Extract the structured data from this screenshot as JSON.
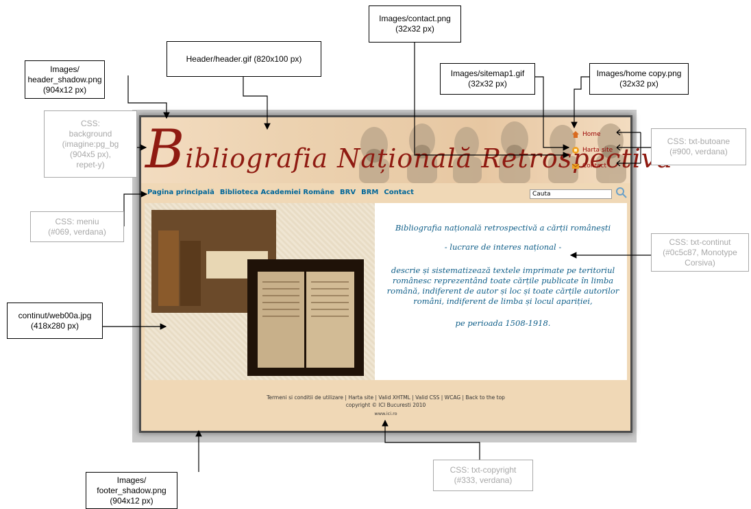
{
  "annotations": {
    "contact_png": [
      "Images/contact.png",
      "(32x32 px)"
    ],
    "header_gif": [
      "Header/header.gif (820x100 px)"
    ],
    "sitemap_gif": [
      "Images/sitemap1.gif",
      "(32x32 px)"
    ],
    "home_png": [
      "Images/home copy.png",
      "(32x32 px)"
    ],
    "header_shadow": [
      "Images/",
      "header_shadow.png",
      "(904x12 px)"
    ],
    "css_background": [
      "CSS:",
      "background",
      "(imagine:pg_bg",
      "(904x5 px),",
      "repet-y)"
    ],
    "css_butoane": [
      "CSS: txt-butoane",
      "(#900, verdana)"
    ],
    "css_meniu": [
      "CSS: meniu",
      "(#069, verdana)"
    ],
    "css_continut": [
      "CSS: txt-continut",
      "(#0c5c87, Monotype",
      "Corsiva)"
    ],
    "continut_jpg": [
      "continut/web00a.jpg",
      "(418x280 px)"
    ],
    "css_copyright": [
      "CSS: txt-copyright",
      "(#333, verdana)"
    ],
    "footer_shadow": [
      "Images/",
      "footer_shadow.png",
      "(904x12 px)"
    ]
  },
  "site": {
    "logo_initial": "B",
    "logo_rest": "ibliografia Națională Retrospectivă",
    "top_nav": [
      {
        "label": "Home",
        "icon": "home-icon"
      },
      {
        "label": "Harta site",
        "icon": "sitemap-icon"
      },
      {
        "label": "Contact",
        "icon": "contact-icon"
      }
    ],
    "menu": [
      "Pagina principală",
      "Biblioteca Academiei Române",
      "BRV",
      "BRM",
      "Contact"
    ],
    "search_value": "Cauta",
    "content": [
      "Bibliografia națională retrospectivă a cărții românești",
      "- lucrare de interes național -",
      "descrie și sistematizează textele imprimate pe teritoriul românesc reprezentând toate cărțile publicate în limba română, indiferent de autor și loc și toate cărțile autorilor români, indiferent de limba și locul apariției,",
      "pe perioada 1508-1918."
    ],
    "footer": {
      "links": "Termeni si conditii de utilizare | Harta site | Valid XHTML | Valid CSS | WCAG | Back to the top",
      "copyright": "copyright © ICI Bucuresti 2010",
      "url": "www.ici.ro"
    }
  },
  "colors": {
    "butoane": "#990000",
    "meniu": "#006699",
    "continut": "#0c5c87",
    "copyright": "#333333",
    "header_bg": "#f0d8b6"
  }
}
